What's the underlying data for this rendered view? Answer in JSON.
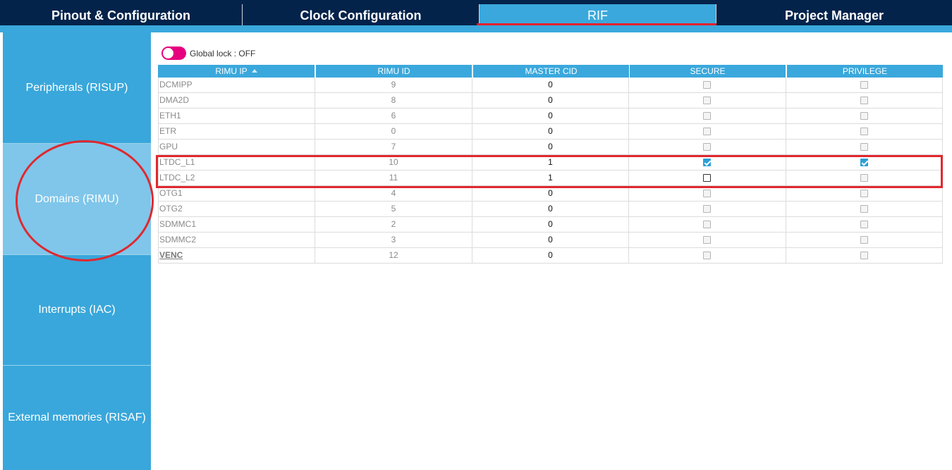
{
  "tabs": [
    {
      "label": "Pinout & Configuration"
    },
    {
      "label": "Clock Configuration"
    },
    {
      "label": "RIF"
    },
    {
      "label": "Project Manager"
    }
  ],
  "sidebar": {
    "items": [
      {
        "label": "Peripherals (RISUP)"
      },
      {
        "label": "Domains (RIMU)"
      },
      {
        "label": "Interrupts (IAC)"
      },
      {
        "label": "External memories (RISAF)"
      }
    ]
  },
  "global_lock": {
    "label": "Global lock : OFF",
    "state": "off"
  },
  "table": {
    "headers": [
      "RIMU IP",
      "RIMU ID",
      "MASTER CID",
      "SECURE",
      "PRIVILEGE"
    ],
    "rows": [
      {
        "ip": "DCMIPP",
        "id": "9",
        "cid": "0",
        "secure": false,
        "privilege": false
      },
      {
        "ip": "DMA2D",
        "id": "8",
        "cid": "0",
        "secure": false,
        "privilege": false
      },
      {
        "ip": "ETH1",
        "id": "6",
        "cid": "0",
        "secure": false,
        "privilege": false
      },
      {
        "ip": "ETR",
        "id": "0",
        "cid": "0",
        "secure": false,
        "privilege": false
      },
      {
        "ip": "GPU",
        "id": "7",
        "cid": "0",
        "secure": false,
        "privilege": false
      },
      {
        "ip": "LTDC_L1",
        "id": "10",
        "cid": "1",
        "secure": true,
        "privilege": true
      },
      {
        "ip": "LTDC_L2",
        "id": "11",
        "cid": "1",
        "secure": false,
        "privilege": false
      },
      {
        "ip": "OTG1",
        "id": "4",
        "cid": "0",
        "secure": false,
        "privilege": false
      },
      {
        "ip": "OTG2",
        "id": "5",
        "cid": "0",
        "secure": false,
        "privilege": false
      },
      {
        "ip": "SDMMC1",
        "id": "2",
        "cid": "0",
        "secure": false,
        "privilege": false
      },
      {
        "ip": "SDMMC2",
        "id": "3",
        "cid": "0",
        "secure": false,
        "privilege": false
      },
      {
        "ip": "VENC",
        "id": "12",
        "cid": "0",
        "secure": false,
        "privilege": false
      }
    ]
  },
  "colors": {
    "accent": "#3aa8dc",
    "header_bg": "#03234b",
    "annotation": "#e0282f",
    "toggle": "#e6007e"
  }
}
